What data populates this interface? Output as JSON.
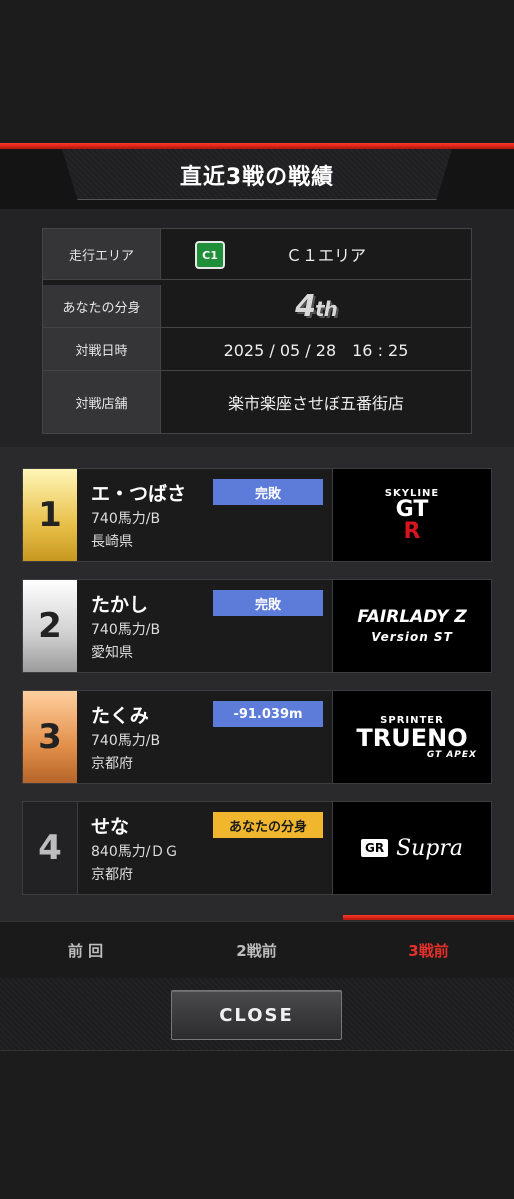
{
  "header": {
    "title": "直近3戦の戦績"
  },
  "info": {
    "rows": [
      {
        "label": "走行エリア",
        "value": "Ｃ１エリア",
        "badge": "C1"
      },
      {
        "label": "あなたの分身",
        "value_main": "4",
        "value_suffix": "th"
      },
      {
        "label": "対戦日時",
        "value": "2025 / 05 / 28　16 : 25"
      },
      {
        "label": "対戦店舗",
        "value": "楽市楽座させぼ五番街店"
      }
    ]
  },
  "results": [
    {
      "rank": "1",
      "name": "エ・つばさ",
      "power": "740馬力/B",
      "pref": "長崎県",
      "status": "完敗",
      "car": {
        "line1": "SKYLINE",
        "line2": "GT",
        "line3": "R"
      }
    },
    {
      "rank": "2",
      "name": "たかし",
      "power": "740馬力/B",
      "pref": "愛知県",
      "status": "完敗",
      "car": {
        "line1": "FAIRLADY Z",
        "line2": "Version ST"
      }
    },
    {
      "rank": "3",
      "name": "たくみ",
      "power": "740馬力/B",
      "pref": "京都府",
      "status": "-91.039m",
      "car": {
        "line1": "SPRINTER",
        "line2": "TRUENO",
        "line3": "GT APEX"
      }
    },
    {
      "rank": "4",
      "name": "せな",
      "power": "840馬力/ＤＧ",
      "pref": "京都府",
      "status": "あなたの分身",
      "car": {
        "line1": "GR",
        "line2": "Supra"
      }
    }
  ],
  "tabs": [
    {
      "label": "前 回"
    },
    {
      "label": "2戦前"
    },
    {
      "label": "3戦前",
      "active": true
    }
  ],
  "close_label": "CLOSE",
  "colors": {
    "accent": "#e4302a",
    "badge_blue": "#5d7bd8",
    "badge_yellow": "#f0b72e"
  }
}
